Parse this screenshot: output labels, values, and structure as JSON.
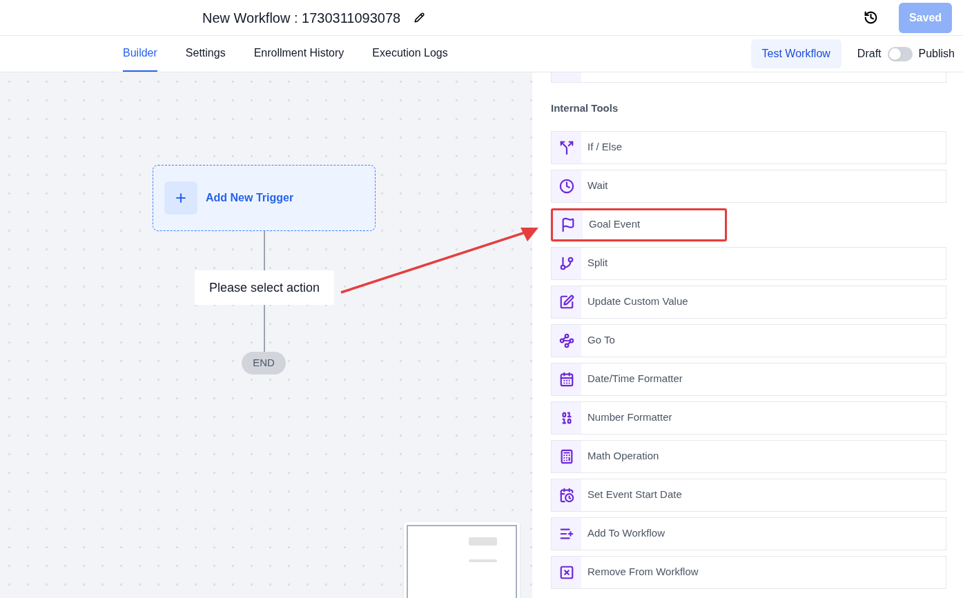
{
  "header": {
    "title": "New Workflow : 1730311093078",
    "save_button": {
      "label": "Saved",
      "disabled": true
    }
  },
  "tabs": [
    {
      "label": "Builder",
      "selected": true
    },
    {
      "label": "Settings",
      "selected": false
    },
    {
      "label": "Enrollment History",
      "selected": false
    },
    {
      "label": "Execution Logs",
      "selected": false
    }
  ],
  "test_button": "Test Workflow",
  "publish_toggle": {
    "off_label": "Draft",
    "on_label": "Publish",
    "on": false
  },
  "canvas": {
    "trigger": "Add New Trigger",
    "action": "Please select action",
    "end": "END"
  },
  "panel": {
    "section": "Internal Tools",
    "items": [
      {
        "label": "If / Else",
        "highlighted": false
      },
      {
        "label": "Wait",
        "highlighted": false
      },
      {
        "label": "Goal Event",
        "highlighted": true
      },
      {
        "label": "Split",
        "highlighted": false
      },
      {
        "label": "Update Custom Value",
        "highlighted": false
      },
      {
        "label": "Go To",
        "highlighted": false
      },
      {
        "label": "Date/Time Formatter",
        "highlighted": false
      },
      {
        "label": "Number Formatter",
        "highlighted": false
      },
      {
        "label": "Math Operation",
        "highlighted": false
      },
      {
        "label": "Set Event Start Date",
        "highlighted": false
      },
      {
        "label": "Add To Workflow",
        "highlighted": false
      },
      {
        "label": "Remove From Workflow",
        "highlighted": false
      }
    ]
  }
}
